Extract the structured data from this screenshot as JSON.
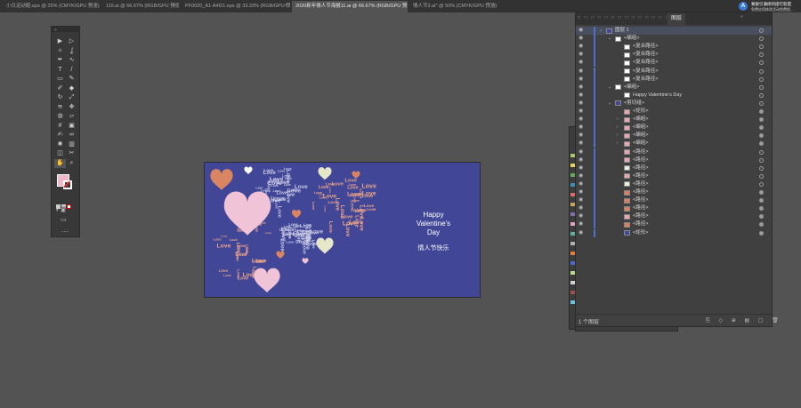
{
  "tabs": [
    {
      "label": "小日运动鞋.eps @ 25% (CMYK/GPU 预览)",
      "active": false
    },
    {
      "label": "115.ai @ 66.67% (RGB/GPU 预览)",
      "active": false
    },
    {
      "label": "PF0020_A1-A4f21.eps @ 33.33% (RGB/GPU 预览)",
      "active": false
    },
    {
      "label": "2020新年情人节海报11.ai @ 66.67% (RGB/GPU 预览)",
      "active": true
    },
    {
      "label": "情人节3.ai* @ 50% (CMYK/GPU 预览)",
      "active": false
    }
  ],
  "notification": {
    "line1": "要脱引满修的提行软盟",
    "line2": "免费应用体验活动免费程..."
  },
  "artboard": {
    "title_lines": [
      "Happy",
      "Valentine's",
      "Day"
    ],
    "subtitle": "情人节快乐",
    "heart_word": "Love",
    "colors": {
      "background": "#414796",
      "pink": "#f0c4d6",
      "coral": "#d98562",
      "cream": "#e6e6c8",
      "peach": "#e8a28a"
    }
  },
  "layers_panel": {
    "tab_label": "图层",
    "close_label": "»",
    "rows": [
      {
        "label": "图层 1",
        "indent": 0,
        "expanded": true,
        "thumb": "layer",
        "target": "hollow",
        "selected": true
      },
      {
        "label": "<编组>",
        "indent": 1,
        "expanded": true,
        "thumb": "white",
        "target": "hollow"
      },
      {
        "label": "<复合路径>",
        "indent": 2,
        "thumb": "white",
        "target": "hollow"
      },
      {
        "label": "<复合路径>",
        "indent": 2,
        "thumb": "white",
        "target": "hollow"
      },
      {
        "label": "<复合路径>",
        "indent": 2,
        "thumb": "white",
        "target": "hollow"
      },
      {
        "label": "<复合路径>",
        "indent": 2,
        "thumb": "white",
        "target": "hollow"
      },
      {
        "label": "<复合路径>",
        "indent": 2,
        "thumb": "white",
        "target": "hollow"
      },
      {
        "label": "<编组>",
        "indent": 1,
        "expanded": true,
        "thumb": "white",
        "target": "hollow"
      },
      {
        "label": "Happy Valentine’s Day",
        "indent": 2,
        "thumb": "white",
        "target": "hollow"
      },
      {
        "label": "<剪切组>",
        "indent": 1,
        "expanded": true,
        "thumb": "layer",
        "target": "hollow"
      },
      {
        "label": "<矩形>",
        "indent": 2,
        "thumb": "pink",
        "target": "filled"
      },
      {
        "label": "<编组>",
        "indent": 2,
        "collapsed": true,
        "thumb": "pink",
        "target": "filled"
      },
      {
        "label": "<编组>",
        "indent": 2,
        "collapsed": true,
        "thumb": "pink",
        "target": "filled"
      },
      {
        "label": "<编组>",
        "indent": 2,
        "collapsed": true,
        "thumb": "pink",
        "target": "filled"
      },
      {
        "label": "<编组>",
        "indent": 2,
        "collapsed": true,
        "thumb": "pink",
        "target": "filled"
      },
      {
        "label": "<路径>",
        "indent": 2,
        "thumb": "pink",
        "target": "hollow"
      },
      {
        "label": "<路径>",
        "indent": 2,
        "thumb": "pink",
        "target": "hollow"
      },
      {
        "label": "<路径>",
        "indent": 2,
        "thumb": "cream",
        "target": "hollow"
      },
      {
        "label": "<路径>",
        "indent": 2,
        "thumb": "pink",
        "target": "hollow"
      },
      {
        "label": "<路径>",
        "indent": 2,
        "thumb": "cream",
        "target": "hollow"
      },
      {
        "label": "<路径>",
        "indent": 2,
        "thumb": "coral",
        "target": "filled"
      },
      {
        "label": "<路径>",
        "indent": 2,
        "thumb": "coral",
        "target": "filled"
      },
      {
        "label": "<路径>",
        "indent": 2,
        "thumb": "coral",
        "target": "filled"
      },
      {
        "label": "<路径>",
        "indent": 2,
        "thumb": "pink",
        "target": "filled"
      },
      {
        "label": "<路径>",
        "indent": 2,
        "thumb": "coral",
        "target": "filled"
      },
      {
        "label": "<矩形>",
        "indent": 2,
        "thumb": "blue",
        "target": "filled"
      }
    ],
    "footer_count": "1 个图层"
  },
  "tool_icons": [
    "selection-tool",
    "direct-selection-tool",
    "magic-wand-tool",
    "lasso-tool",
    "pen-tool",
    "curvature-tool",
    "type-tool",
    "line-tool",
    "rectangle-tool",
    "paintbrush-tool",
    "shaper-tool",
    "eraser-tool",
    "rotate-tool",
    "scale-tool",
    "width-tool",
    "puppet-warp-tool",
    "shape-builder-tool",
    "perspective-tool",
    "mesh-tool",
    "gradient-tool",
    "eyedropper-tool",
    "blend-tool",
    "symbol-sprayer-tool",
    "graph-tool",
    "artboard-tool",
    "slice-tool",
    "hand-tool",
    "zoom-tool"
  ]
}
